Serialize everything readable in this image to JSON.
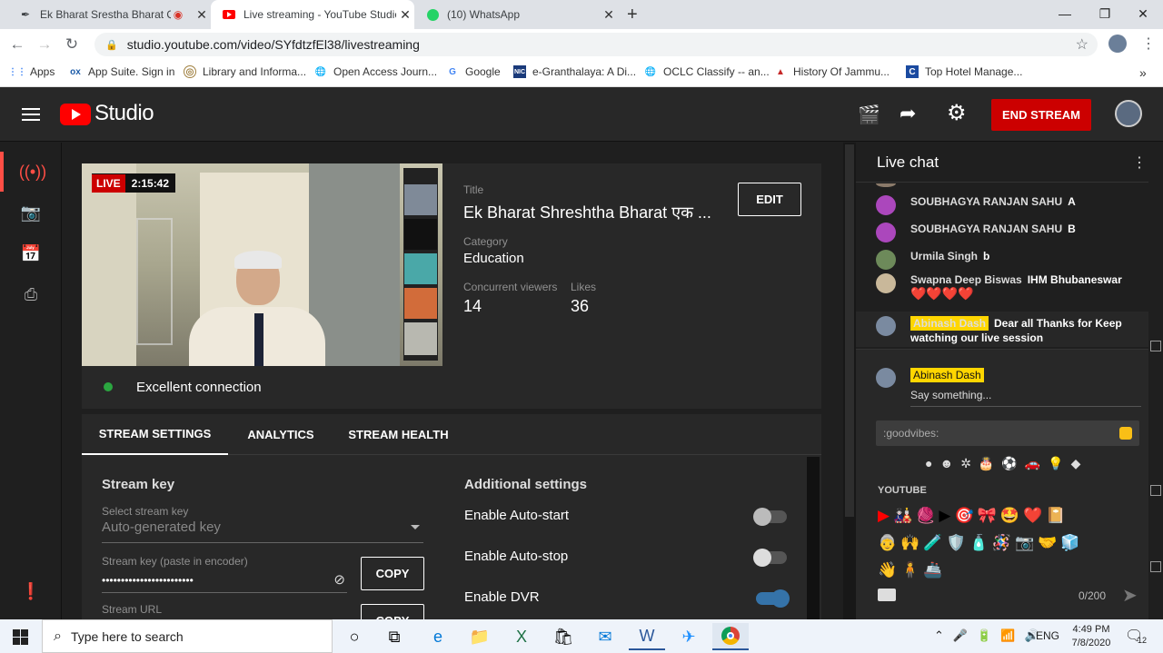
{
  "browser": {
    "tabs": [
      {
        "title": "Ek Bharat Srestha Bharat Qui",
        "icon": "feather-icon",
        "active": false
      },
      {
        "title": "Live streaming - YouTube Studio",
        "icon": "youtube-icon",
        "active": true
      },
      {
        "title": "(10) WhatsApp",
        "icon": "whatsapp-icon",
        "active": false
      }
    ],
    "url": "studio.youtube.com/video/SYfdtzfEl38/livestreaming",
    "bookmarks": [
      {
        "label": "Apps",
        "icon": "apps-grid-icon"
      },
      {
        "label": "App Suite. Sign in",
        "icon": "ox-icon"
      },
      {
        "label": "Library and Informa...",
        "icon": "library-icon"
      },
      {
        "label": "Open Access Journ...",
        "icon": "globe-icon"
      },
      {
        "label": "Google",
        "icon": "google-icon"
      },
      {
        "label": "e-Granthalaya: A Di...",
        "icon": "nic-icon"
      },
      {
        "label": "OCLC Classify -- an...",
        "icon": "globe-icon"
      },
      {
        "label": "History Of Jammu...",
        "icon": "triangle-icon"
      },
      {
        "label": "Top Hotel Manage...",
        "icon": "c-icon"
      }
    ]
  },
  "header": {
    "logo_text": "Studio",
    "end_stream_label": "END STREAM"
  },
  "stream": {
    "live_label": "LIVE",
    "elapsed": "2:15:42",
    "connection_status": "Excellent connection",
    "title_label": "Title",
    "title": "Ek Bharat Shreshtha Bharat एक ...",
    "edit_label": "EDIT",
    "category_label": "Category",
    "category": "Education",
    "viewers_label": "Concurrent viewers",
    "viewers": "14",
    "likes_label": "Likes",
    "likes": "36"
  },
  "tabs": [
    "STREAM SETTINGS",
    "ANALYTICS",
    "STREAM HEALTH"
  ],
  "settings": {
    "stream_key_heading": "Stream key",
    "select_key_label": "Select stream key",
    "select_key_value": "Auto-generated key",
    "key_label": "Stream key (paste in encoder)",
    "key_value": "••••••••••••••••••••••••",
    "copy_label": "COPY",
    "url_label": "Stream URL",
    "copy2_label": "COPY",
    "additional_heading": "Additional settings",
    "toggles": [
      {
        "label": "Enable Auto-start",
        "on": false
      },
      {
        "label": "Enable Auto-stop",
        "on": false
      },
      {
        "label": "Enable DVR",
        "on": true
      }
    ]
  },
  "chat": {
    "title": "Live chat",
    "messages": [
      {
        "author": "SOUBHAGYA RANJAN SAHU",
        "text": "A",
        "avatar_color": "#ab47bc"
      },
      {
        "author": "SOUBHAGYA RANJAN SAHU",
        "text": "B",
        "avatar_color": "#ab47bc"
      },
      {
        "author": "Urmila Singh",
        "text": "b",
        "avatar_color": "#6d8a5a"
      },
      {
        "author": "Swapna Deep Biswas",
        "text": "IHM Bhubaneswar",
        "avatar_color": "#c9b89a"
      },
      {
        "author": "Abinash Dash",
        "text": "Dear all Thanks for Keep watching our live session",
        "avatar_color": "#7a8aa0"
      }
    ],
    "hearts": "❤️❤️❤️❤️",
    "compose_author": "Abinash Dash",
    "compose_placeholder": "Say something...",
    "emoji_search": ":goodvibes:",
    "emoji_section": "YOUTUBE",
    "counter": "0/200"
  },
  "taskbar": {
    "search_placeholder": "Type here to search",
    "time": "4:49 PM",
    "date": "7/8/2020",
    "lang": "ENG",
    "notif_count": "12"
  }
}
